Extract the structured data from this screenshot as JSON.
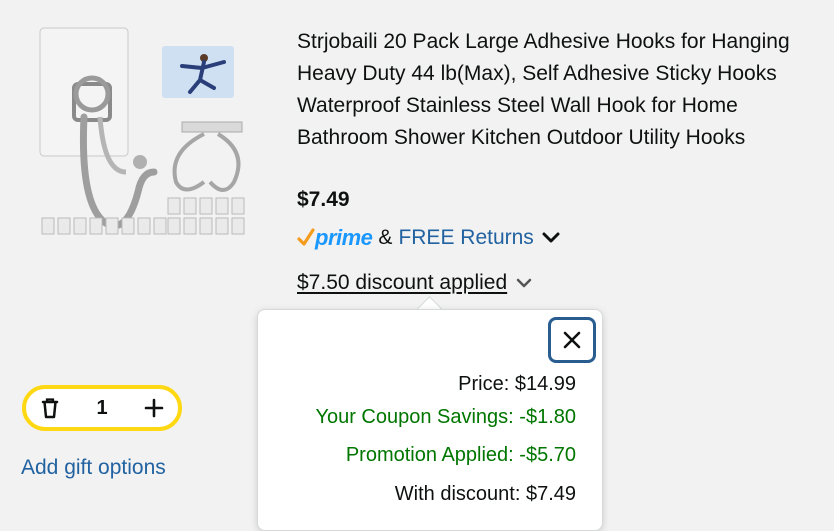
{
  "product": {
    "title": "Strjobaili 20 Pack Large Adhesive Hooks for Hanging Heavy Duty 44 lb(Max), Self Adhesive Sticky Hooks Waterproof Stainless Steel Wall Hook for Home Bathroom Shower Kitchen Outdoor Utility Hooks",
    "price": "$7.49",
    "prime_label": "prime",
    "amp": "&",
    "free_returns": "FREE Returns",
    "discount_text": "$7.50 discount applied"
  },
  "cart": {
    "quantity": "1",
    "gift_link": "Add gift options"
  },
  "popover": {
    "price_line": "Price: $14.99",
    "coupon_line": "Your Coupon Savings: -$1.80",
    "promo_line": "Promotion Applied: -$5.70",
    "final_line": "With discount: $7.49"
  },
  "colors": {
    "link": "#2162a1",
    "savings": "#007600",
    "stepper_border": "#ffd814",
    "prime_orange": "#f39c1e",
    "prime_blue": "#1a98ff"
  },
  "icons": [
    "delete-icon",
    "plus-icon",
    "chevron-down-icon",
    "close-icon",
    "prime-check-icon"
  ]
}
